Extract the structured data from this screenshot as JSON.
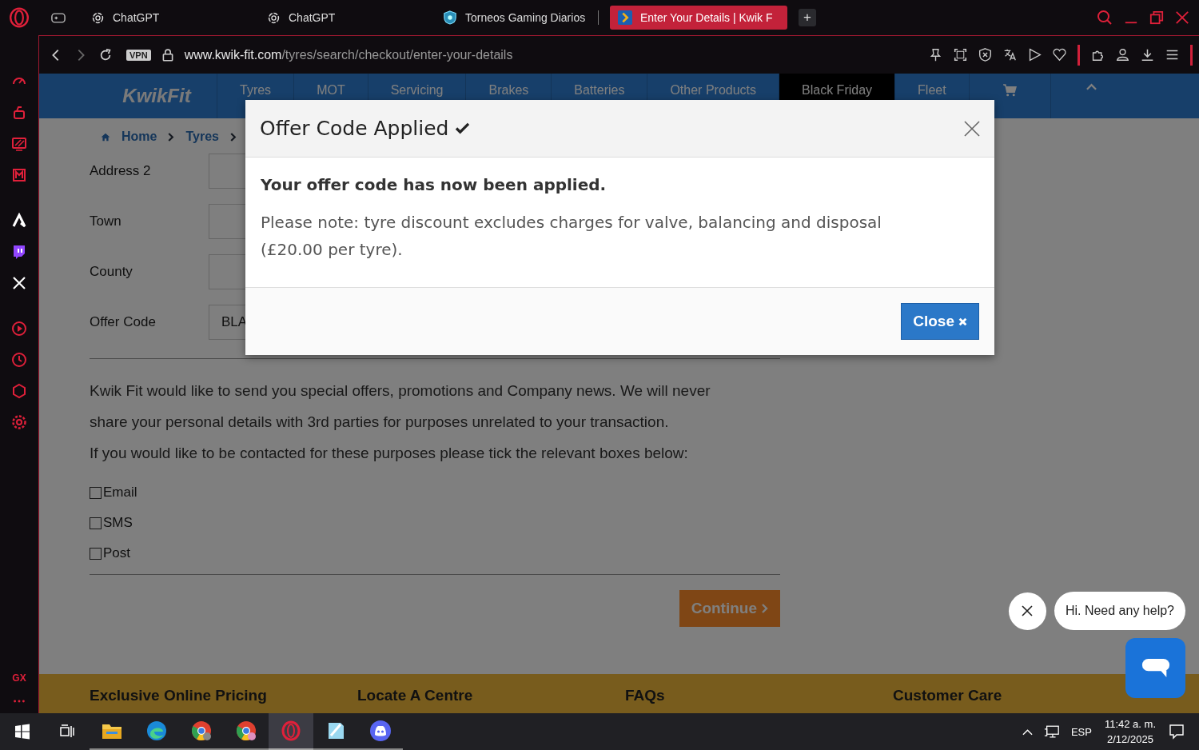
{
  "browser": {
    "tabs": [
      {
        "kind": "chatgpt",
        "title": "ChatGPT",
        "selected": false
      },
      {
        "kind": "chatgpt",
        "title": "ChatGPT",
        "selected": false
      },
      {
        "kind": "shield",
        "title": "Torneos Gaming Diarios",
        "selected": false
      },
      {
        "kind": "kwikfit",
        "title": "Enter Your Details | Kwik F",
        "selected": true
      }
    ],
    "new_tab": "+",
    "vpn": "VPN",
    "url": {
      "domain": "www.kwik-fit.com",
      "path": "/tyres/search/checkout/enter-your-details"
    },
    "sidebar_badge": "GX"
  },
  "site": {
    "nav": [
      {
        "kind": "text",
        "label": "Tyres",
        "selected": false
      },
      {
        "kind": "text",
        "label": "MOT",
        "selected": false
      },
      {
        "kind": "text",
        "label": "Servicing",
        "selected": false
      },
      {
        "kind": "text",
        "label": "Brakes",
        "selected": false
      },
      {
        "kind": "text",
        "label": "Batteries",
        "selected": false
      },
      {
        "kind": "text",
        "label": "Other Products",
        "selected": false
      },
      {
        "kind": "text",
        "label": "Black Friday",
        "selected": true
      },
      {
        "kind": "text",
        "label": "Fleet",
        "selected": false
      },
      {
        "kind": "cart",
        "selected": false
      },
      {
        "kind": "caret",
        "selected": false
      }
    ],
    "logo": "KwikFit",
    "breadcrumb": [
      "Home",
      "Tyres"
    ],
    "form": [
      {
        "label": "Address 2"
      },
      {
        "label": "Town"
      },
      {
        "label": "County"
      },
      {
        "label": "Offer Code",
        "value": "BLA"
      }
    ],
    "consent_text": [
      "Kwik Fit would like to send you special offers, promotions and Company news. We will never",
      "share your personal details with 3rd parties for purposes unrelated to your transaction.",
      "If you would like to be contacted for these purposes please tick the relevant boxes below:"
    ],
    "contact_options": [
      {
        "label": "Email",
        "checked": false
      },
      {
        "label": "SMS",
        "checked": false
      },
      {
        "label": "Post",
        "checked": false
      }
    ],
    "continue_button": "Continue",
    "footer_headings": [
      "Exclusive Online Pricing",
      "Locate A Centre",
      "FAQs",
      "Customer Care"
    ]
  },
  "modal": {
    "title": "Offer Code Applied",
    "heading": "Your offer code has now been applied.",
    "note": "Please note: tyre discount excludes charges for valve, balancing and disposal (£20.00 per tyre).",
    "close_button": "Close"
  },
  "chat": {
    "greeting": "Hi. Need any help?"
  },
  "taskbar": {
    "apps": [
      {
        "kind": "files",
        "selected": false
      },
      {
        "kind": "edge",
        "selected": false
      },
      {
        "kind": "chrome",
        "selected": false
      },
      {
        "kind": "chrome2",
        "selected": false
      },
      {
        "kind": "opera",
        "selected": true
      },
      {
        "kind": "notes",
        "selected": false
      },
      {
        "kind": "discord",
        "selected": false
      }
    ],
    "language": "ESP",
    "time": "11:42 a. m.",
    "date": "2/12/2025"
  }
}
